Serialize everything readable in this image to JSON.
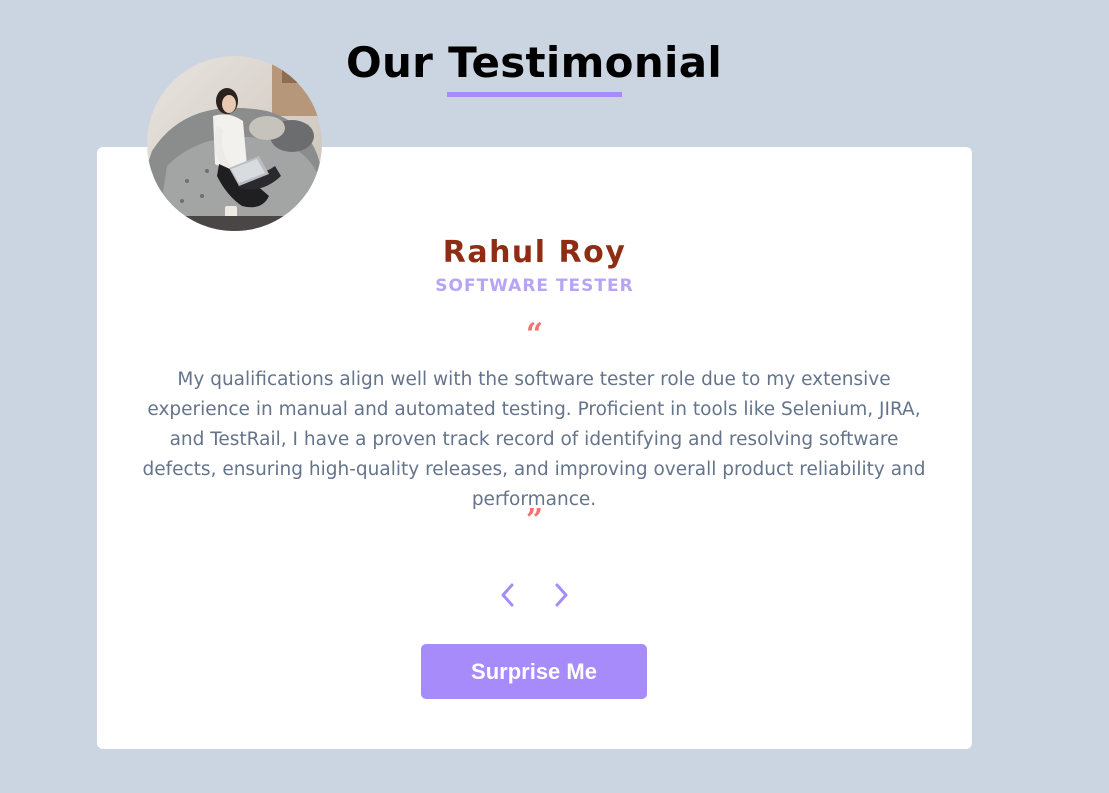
{
  "header": {
    "title": "Our Testimonial"
  },
  "testimonial": {
    "name": "Rahul Roy",
    "role": "SOFTWARE TESTER",
    "quote_open": "“",
    "quote_close": "”",
    "text": "My qualifications align well with the software tester role due to my extensive experience in manual and automated testing. Proficient in tools like Selenium, JIRA, and TestRail, I have a proven track record of identifying and resolving software defects, ensuring high-quality releases, and improving overall product reliability and performance."
  },
  "controls": {
    "prev_icon": "chevron-left-icon",
    "next_icon": "chevron-right-icon",
    "surprise_label": "Surprise Me"
  },
  "colors": {
    "background": "#cbd5e1",
    "accent": "#a78bfa",
    "name": "#8f2d14",
    "role": "#b8a4f5",
    "quote_mark": "#f87171",
    "body_text": "#64748b"
  }
}
